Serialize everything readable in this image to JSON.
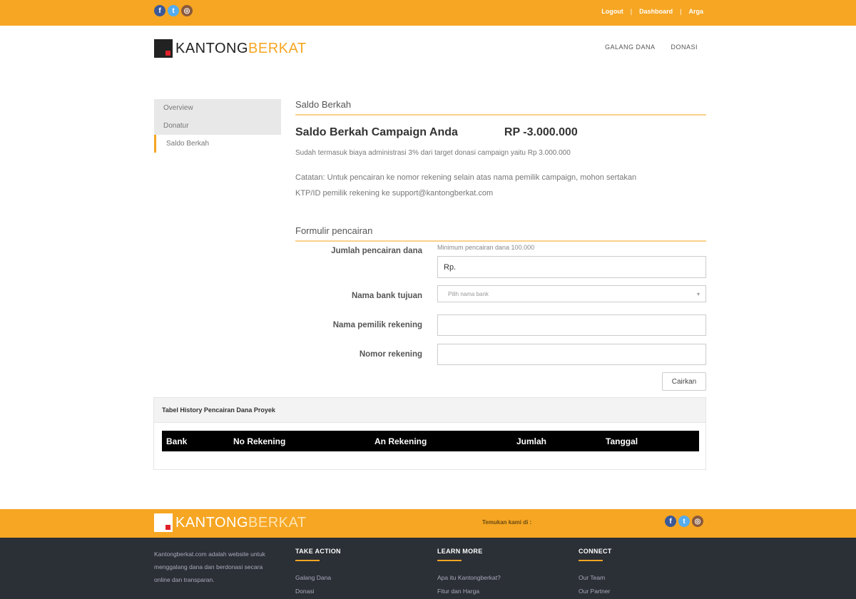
{
  "topbar": {
    "social_icons": [
      "facebook-icon",
      "twitter-icon",
      "instagram-icon"
    ],
    "links": [
      "Logout",
      "Dashboard",
      "Arga"
    ]
  },
  "brand": {
    "part1": "KANTONG",
    "part2": "BERKAT"
  },
  "nav": {
    "items": [
      "GALANG DANA",
      "DONASI"
    ]
  },
  "sidebar": {
    "items": [
      "Overview",
      "Donatur",
      "Saldo Berkah"
    ]
  },
  "main": {
    "section_title": "Saldo Berkah",
    "saldo_label": "Saldo Berkah Campaign Anda",
    "saldo_amount": "RP -3.000.000",
    "fee_note": "Sudah termasuk biaya administrasi 3% dari target donasi campaign yaitu Rp 3.000.000",
    "catatan_line1": "Catatan: Untuk pencairan ke nomor rekening selain atas nama pemilik campaign, mohon sertakan",
    "catatan_line2": "KTP/ID pemilik rekening ke support@kantongberkat.com"
  },
  "form": {
    "title": "Formulir pencairan",
    "amount_label": "Jumlah pencairan dana",
    "amount_hint": "Minimum pencairan dana 100.000",
    "amount_value": "Rp.",
    "bank_label": "Nama bank tujuan",
    "bank_placeholder": "Pilih nama bank",
    "owner_label": "Nama pemilik rekening",
    "account_label": "Nomor rekening",
    "submit_label": "Cairkan"
  },
  "history": {
    "title": "Tabel History Pencairan Dana Proyek",
    "columns": [
      "Bank",
      "No Rekening",
      "An Rekening",
      "Jumlah",
      "Tanggal"
    ]
  },
  "footer": {
    "follow_text": "Temukan kami di :",
    "about": "Kantongberkat.com adalah website untuk menggalang dana dan berdonasi secara online dan transparan.",
    "columns": [
      {
        "title": "TAKE ACTION",
        "links": [
          "Galang Dana",
          "Donasi"
        ]
      },
      {
        "title": "LEARN MORE",
        "links": [
          "Apa itu Kantongberkat?",
          "Fitur dan Harga"
        ]
      },
      {
        "title": "CONNECT",
        "links": [
          "Our Team",
          "Our Partner"
        ]
      }
    ]
  },
  "colors": {
    "accent": "#f6a623",
    "footer_dark": "#2b2f36",
    "table_header": "#000000"
  }
}
